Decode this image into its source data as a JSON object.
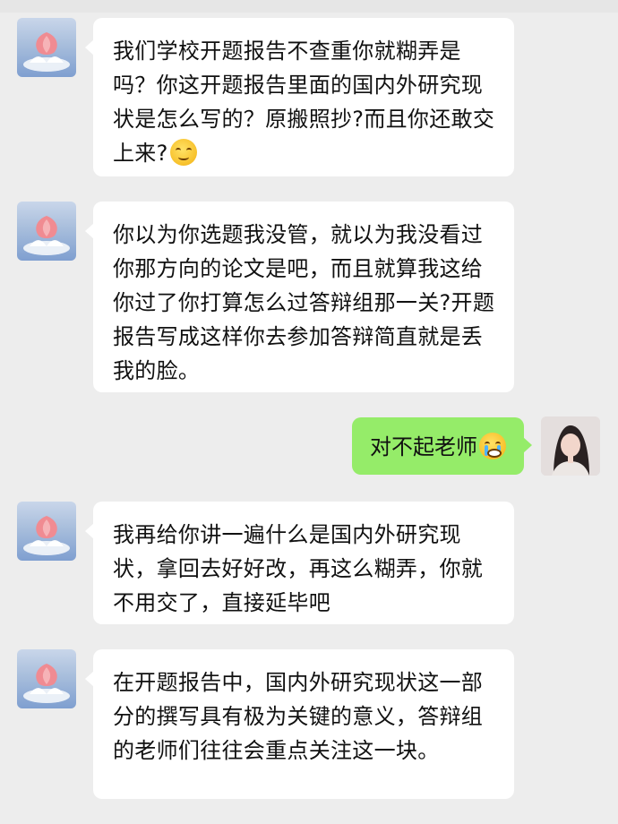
{
  "chat": {
    "messages": [
      {
        "sender": "teacher",
        "text": "我们学校开题报告不查重你就糊弄是吗？你这开题报告里面的国内外研究现状是怎么写的？原搬照抄?而且你还敢交上来?",
        "emoji": "smile-emoji"
      },
      {
        "sender": "teacher",
        "text": "你以为你选题我没管，就以为我没看过你那方向的论文是吧，而且就算我这给你过了你打算怎么过答辩组那一关?开题报告写成这样你去参加答辩简直就是丢我的脸。"
      },
      {
        "sender": "me",
        "text": "对不起老师",
        "emoji": "crying-emoji"
      },
      {
        "sender": "teacher",
        "text": "我再给你讲一遍什么是国内外研究现状，拿回去好好改，再这么糊弄，你就不用交了，直接延毕吧"
      },
      {
        "sender": "teacher",
        "text": "在开题报告中，国内外研究现状这一部分的撰写具有极为关键的意义，答辩组的老师们往往会重点关注这一块。"
      }
    ]
  },
  "colors": {
    "background": "#ededed",
    "incoming_bubble": "#ffffff",
    "outgoing_bubble": "#95ec69"
  }
}
